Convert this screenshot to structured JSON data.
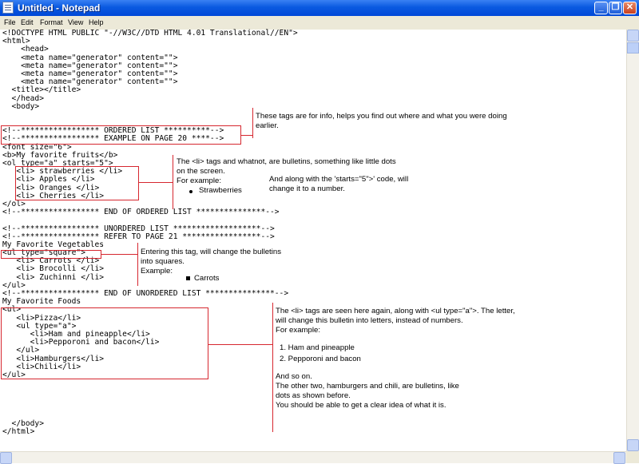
{
  "window": {
    "title": "Untitled - Notepad"
  },
  "menu": [
    "File",
    "Edit",
    "Format",
    "View",
    "Help"
  ],
  "code_lines": [
    "<!DOCTYPE HTML PUBLIC \"-//W3C//DTD HTML 4.01 Translational//EN\">",
    "<html>",
    "    <head>",
    "    <meta name=\"generator\" content=\"\">",
    "    <meta name=\"generator\" content=\"\">",
    "    <meta name=\"generator\" content=\"\">",
    "    <meta name=\"generator\" content=\"\">",
    "  <title></title>",
    "  </head>",
    "  <body>",
    "",
    "",
    "<!--***************** ORDERED LIST **********-->",
    "<!--***************** EXAMPLE ON PAGE 20 ****-->",
    "<font size=\"6\">",
    "<b>My favorite fruits</b>",
    "<ol type=\"a\" starts=\"5\">",
    "   <li> strawberries </li>",
    "   <li> Apples </li>",
    "   <li> Oranges </li>",
    "   <li> Cherries </li>",
    "</ol>",
    "<!--***************** END OF ORDERED LIST ***************-->",
    "",
    "<!--***************** UNORDERED LIST *******************-->",
    "<!--***************** REFER TO PAGE 21 *****************-->",
    "My Favorite Vegetables",
    "<ul type=\"square\">",
    "   <li> Carrots </li>",
    "   <li> Brocolli </li>",
    "   <li> Zuchinni </li>",
    "</ul>",
    "<!--***************** END OF UNORDERED LIST ***************-->",
    "My Favorite Foods",
    "<ul>",
    "   <li>Pizza</li>",
    "   <ul type=\"a\">",
    "      <li>Ham and pineapple</li>",
    "      <li>Pepporoni and bacon</li>",
    "   </ul>",
    "   <li>Hamburgers</li>",
    "   <li>Chili</li>",
    "</ul>",
    "",
    "",
    "",
    "",
    "",
    "  </body>",
    "</html>"
  ],
  "notes": {
    "info": [
      "These tags are for info, helps you find out where and what you were doing",
      "earlier."
    ],
    "li": [
      "The <li> tags and whatnot, are bulletins, something like little dots",
      "on the screen.",
      "For example:",
      "Strawberries"
    ],
    "starts": [
      "And along with the 'starts=\"5\">' code, will",
      "change it to a number."
    ],
    "square": [
      "Entering this tag, will change the bulletins",
      "into squares.",
      "Example:",
      "Carrots"
    ],
    "foods": [
      "The <li> tags are seen here again, along with <ul type=\"a\">. The letter,",
      "will change this bulletin into letters, instead of numbers.",
      "For example:",
      "1. Ham and pineapple",
      "2. Pepporoni and bacon",
      "And so on.",
      "The other two, hamburgers and chili, are bulletins, like",
      "dots as shown before.",
      "You should be able to get a clear idea of what it is."
    ]
  },
  "icons": {
    "minimize": "minimize-icon",
    "maximize": "maximize-icon",
    "close": "close-icon",
    "app": "notepad-icon"
  }
}
